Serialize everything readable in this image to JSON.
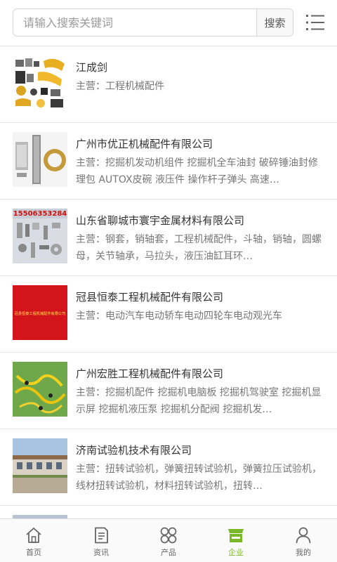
{
  "search": {
    "placeholder": "请输入搜索关键词",
    "button_label": "搜索"
  },
  "companies": [
    {
      "name": "江成剑",
      "desc": "主营：工程机械配件"
    },
    {
      "name": "广州市优正机械配件有限公司",
      "desc": "主营：挖掘机发动机组件 挖掘机全车油封 破碎锤油封修理包 AUTOX皮碗 液压件 操作杆子弹头 高速…"
    },
    {
      "name": "山东省聊城市寰宇金属材料有限公司",
      "desc": "主营：钢套，销轴套，工程机械配件，斗轴，销轴，圆螺母，关节轴承，马拉头，液压油缸耳环…"
    },
    {
      "name": "冠县恒泰工程机械配件有限公司",
      "desc": "主营：电动汽车电动轿车电动四轮车电动观光车"
    },
    {
      "name": "广州宏胜工程机械配件有限公司",
      "desc": "主营：挖掘机配件 挖掘机电脑板 挖掘机驾驶室 挖掘机显示屏 挖掘机液压泵 挖掘机分配阀 挖掘机发…"
    },
    {
      "name": "济南试验机技术有限公司",
      "desc": "主营：扭转试验机，弹簧扭转试验机，弹簧拉压试验机，线材扭转试验机，材料扭转试验机，扭转…"
    }
  ],
  "thumb_text": {
    "phone": "15506353284",
    "company_sign": "冠县恒泰工程机械配件有限公司"
  },
  "tabs": [
    {
      "label": "首页",
      "icon": "home-icon"
    },
    {
      "label": "资讯",
      "icon": "news-icon"
    },
    {
      "label": "产品",
      "icon": "grid-icon"
    },
    {
      "label": "企业",
      "icon": "store-icon"
    },
    {
      "label": "我的",
      "icon": "user-icon"
    }
  ],
  "colors": {
    "accent": "#7ab829",
    "tab_icon": "#666666",
    "divider": "#e4e4e4"
  }
}
